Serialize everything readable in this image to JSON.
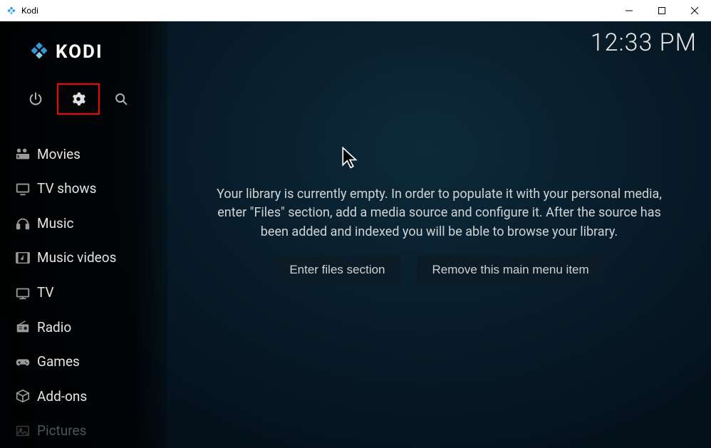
{
  "window": {
    "title": "Kodi"
  },
  "clock": "12:33 PM",
  "brand": "KODI",
  "utilButtons": {
    "power": "power-icon",
    "settings": "gear-icon",
    "search": "search-icon"
  },
  "sidebar": {
    "items": [
      {
        "label": "Movies",
        "icon": "movies-icon"
      },
      {
        "label": "TV shows",
        "icon": "tvshows-icon"
      },
      {
        "label": "Music",
        "icon": "music-icon"
      },
      {
        "label": "Music videos",
        "icon": "musicvideos-icon"
      },
      {
        "label": "TV",
        "icon": "tv-icon"
      },
      {
        "label": "Radio",
        "icon": "radio-icon"
      },
      {
        "label": "Games",
        "icon": "games-icon"
      },
      {
        "label": "Add-ons",
        "icon": "addons-icon"
      },
      {
        "label": "Pictures",
        "icon": "pictures-icon"
      }
    ]
  },
  "main": {
    "emptyMessage": "Your library is currently empty. In order to populate it with your personal media, enter \"Files\" section, add a media source and configure it. After the source has been added and indexed you will be able to browse your library.",
    "enterFilesLabel": "Enter files section",
    "removeItemLabel": "Remove this main menu item"
  }
}
